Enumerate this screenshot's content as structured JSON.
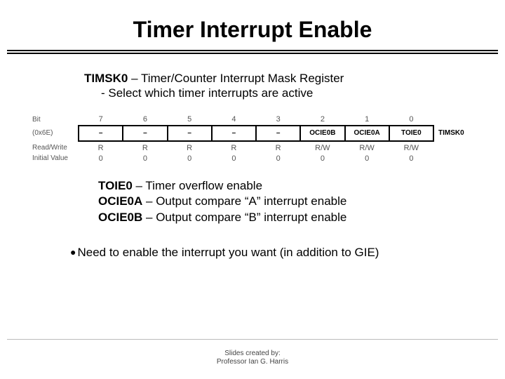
{
  "title": "Timer Interrupt Enable",
  "intro": {
    "reg_name": "TIMSK0",
    "reg_desc": " – Timer/Counter Interrupt Mask Register",
    "sub": "- Select which timer interrupts are active"
  },
  "reg": {
    "row_labels": {
      "bit": "Bit",
      "addr": "(0x6E)",
      "rw": "Read/Write",
      "iv": "Initial Value"
    },
    "bits": [
      "7",
      "6",
      "5",
      "4",
      "3",
      "2",
      "1",
      "0"
    ],
    "names": [
      "–",
      "–",
      "–",
      "–",
      "–",
      "OCIE0B",
      "OCIE0A",
      "TOIE0"
    ],
    "rw": [
      "R",
      "R",
      "R",
      "R",
      "R",
      "R/W",
      "R/W",
      "R/W"
    ],
    "iv": [
      "0",
      "0",
      "0",
      "0",
      "0",
      "0",
      "0",
      "0"
    ],
    "reg_label": "TIMSK0"
  },
  "defs": [
    {
      "b": "TOIE0",
      "t": " – Timer overflow enable"
    },
    {
      "b": "OCIE0A",
      "t": " – Output compare “A” interrupt enable"
    },
    {
      "b": "OCIE0B",
      "t": " – Output compare “B” interrupt enable"
    }
  ],
  "bullet": "Need to enable the interrupt you want (in addition to GIE)",
  "footer": {
    "l1": "Slides created by:",
    "l2": "Professor Ian G. Harris"
  }
}
